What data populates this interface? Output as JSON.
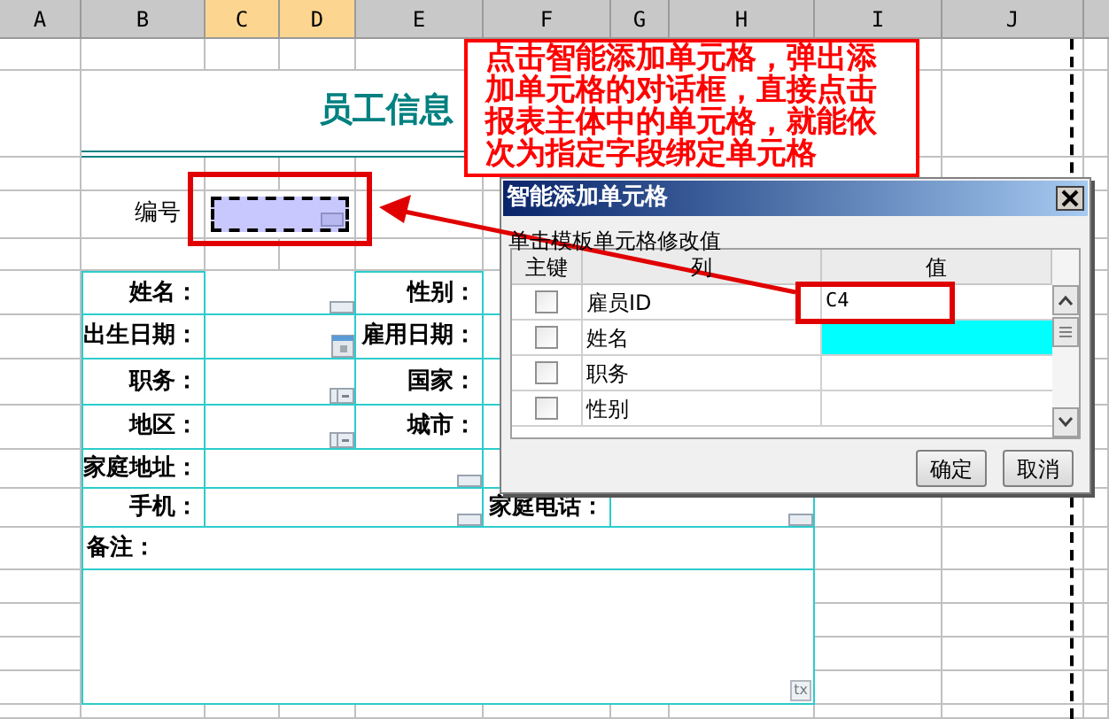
{
  "columns": [
    {
      "label": "A",
      "selected": false
    },
    {
      "label": "B",
      "selected": false
    },
    {
      "label": "C",
      "selected": true
    },
    {
      "label": "D",
      "selected": true
    },
    {
      "label": "E",
      "selected": false
    },
    {
      "label": "F",
      "selected": false
    },
    {
      "label": "G",
      "selected": false
    },
    {
      "label": "H",
      "selected": false
    },
    {
      "label": "I",
      "selected": false
    },
    {
      "label": "J",
      "selected": false
    }
  ],
  "sheet": {
    "title": "员工信息",
    "id_label": "编号",
    "id_cell": {
      "selected": true
    },
    "form": [
      {
        "kind": "pair",
        "label": "姓名：",
        "field": {
          "kind": "text"
        },
        "label2": "性别："
      },
      {
        "kind": "pair",
        "label": "出生日期：",
        "field": {
          "kind": "date"
        },
        "label2": "雇用日期："
      },
      {
        "kind": "pair",
        "label": "职务：",
        "field": {
          "kind": "dropdown"
        },
        "label2": "国家："
      },
      {
        "kind": "pair",
        "label": "地区：",
        "field": {
          "kind": "dropdown"
        },
        "label2": "城市："
      },
      {
        "kind": "wide",
        "label": "家庭地址：",
        "field": {
          "kind": "text"
        }
      },
      {
        "kind": "wide",
        "label": "手机：",
        "field": {
          "kind": "text"
        },
        "label2": "家庭电话：",
        "field2": {
          "kind": "text"
        }
      },
      {
        "kind": "memo",
        "label": "备注：",
        "button": "tx"
      }
    ]
  },
  "callout": "点击智能添加单元格，弹出添加单元格的对话框，直接点击报表主体中的单元格，就能依次为指定字段绑定单元格",
  "dialog": {
    "title": "智能添加单元格",
    "hint": "单击模板单元格修改值",
    "headers": [
      "主键",
      "列",
      "值"
    ],
    "rows": [
      {
        "key": false,
        "column": "雇员ID",
        "value": "C4",
        "selected": false
      },
      {
        "key": false,
        "column": "姓名",
        "selected": true
      },
      {
        "key": false,
        "column": "职务",
        "selected": false
      },
      {
        "key": false,
        "column": "性别",
        "selected": false
      }
    ],
    "buttons": [
      "确定",
      "取消"
    ]
  }
}
